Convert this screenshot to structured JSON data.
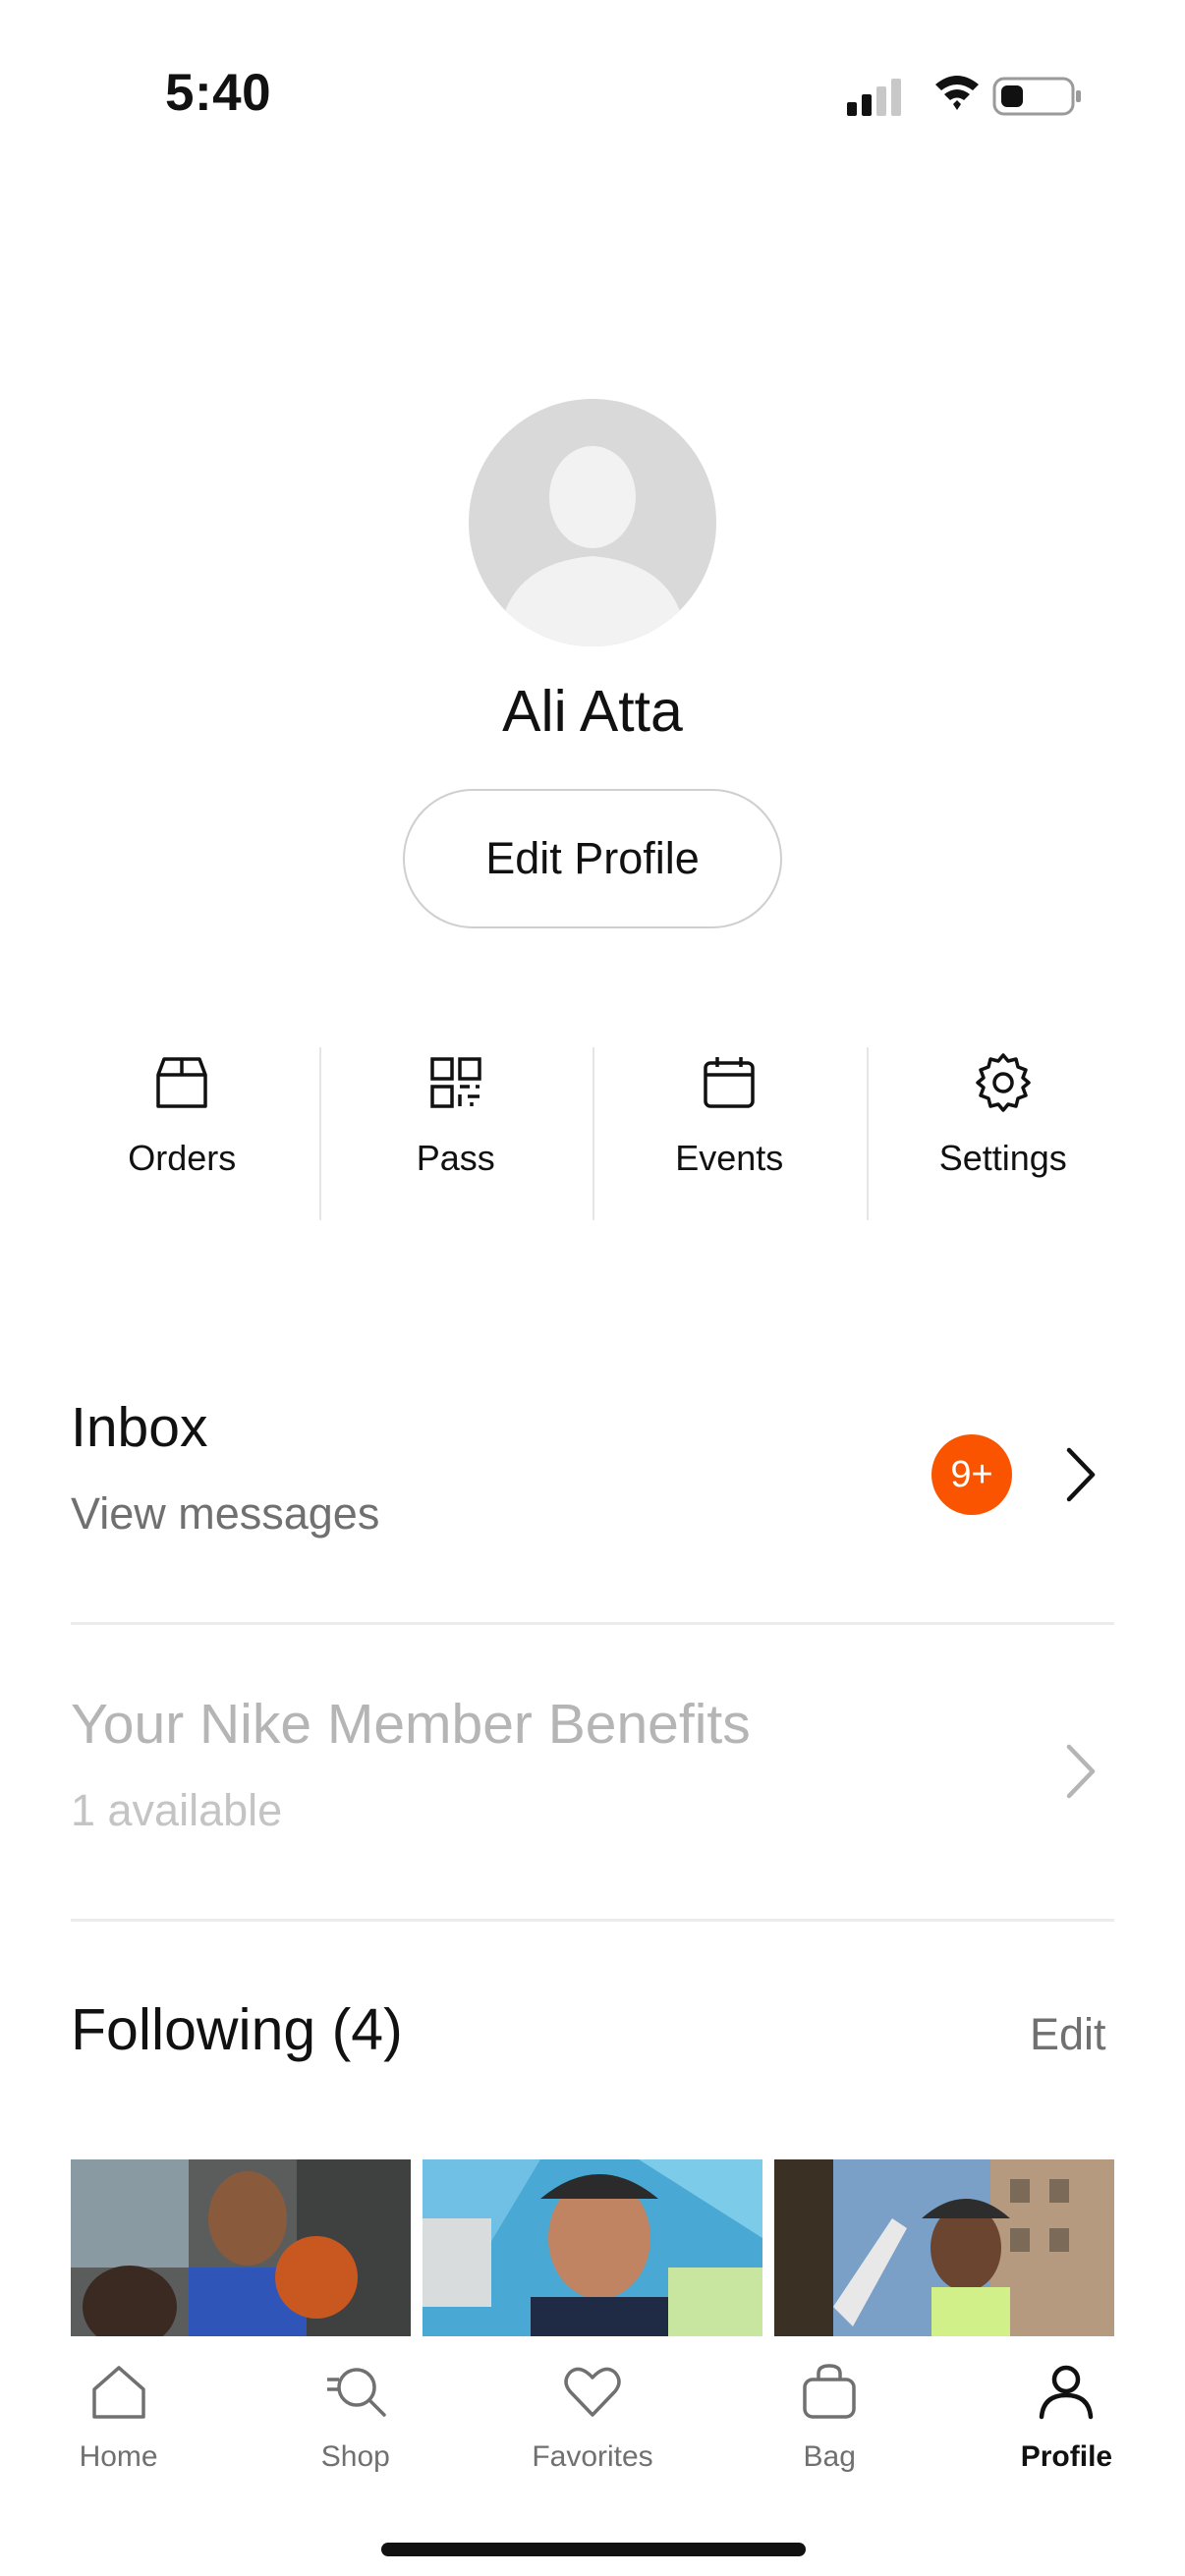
{
  "status_bar": {
    "time": "5:40"
  },
  "profile": {
    "name": "Ali Atta",
    "edit_button": "Edit Profile"
  },
  "quick_actions": [
    {
      "label": "Orders",
      "icon": "box-icon"
    },
    {
      "label": "Pass",
      "icon": "qr-code-icon"
    },
    {
      "label": "Events",
      "icon": "calendar-icon"
    },
    {
      "label": "Settings",
      "icon": "gear-icon"
    }
  ],
  "inbox": {
    "title": "Inbox",
    "subtitle": "View messages",
    "badge": "9+"
  },
  "benefits": {
    "title": "Your Nike Member Benefits",
    "subtitle": "1 available"
  },
  "following": {
    "title": "Following (4)",
    "edit_label": "Edit"
  },
  "tabbar": {
    "items": [
      {
        "label": "Home",
        "icon": "home-icon"
      },
      {
        "label": "Shop",
        "icon": "search-icon"
      },
      {
        "label": "Favorites",
        "icon": "heart-icon"
      },
      {
        "label": "Bag",
        "icon": "bag-icon"
      },
      {
        "label": "Profile",
        "icon": "person-icon"
      }
    ],
    "active": "Profile"
  },
  "colors": {
    "badge": "#fa5400",
    "text_primary": "#111111",
    "text_secondary": "#707070"
  }
}
